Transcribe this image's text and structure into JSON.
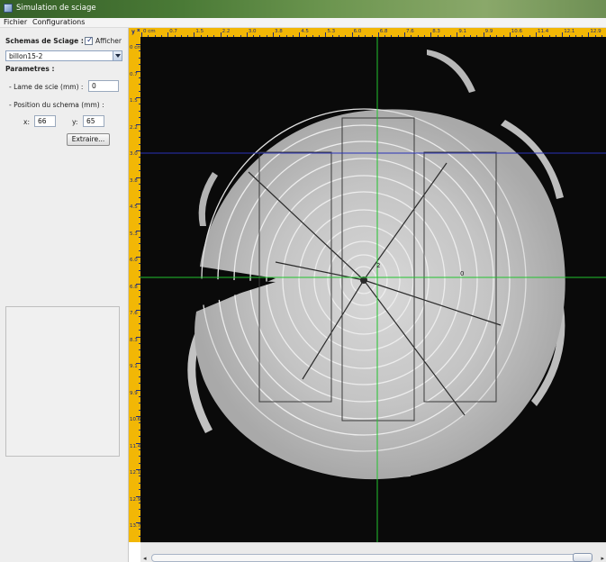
{
  "window": {
    "title": "Simulation de sciage"
  },
  "menu": {
    "items": [
      "Fichier",
      "Configurations"
    ]
  },
  "panel": {
    "schemas_label": "Schemas de Sciage :",
    "afficher_label": "Afficher",
    "afficher_checked": true,
    "selected_schema": "billon15-2",
    "parametres_label": "Parametres :",
    "lame_label": "- Lame de scie (mm) :",
    "lame_value": "0",
    "position_label": "- Position du schema (mm) :",
    "x_label": "x:",
    "x_value": "66",
    "y_label": "y:",
    "y_value": "65",
    "extract_label": "Extraire..."
  },
  "rulers": {
    "corner_y": "y",
    "corner_x": "x",
    "top_labels": [
      "0 cm",
      "0.7",
      "1.5",
      "2.2",
      "3.0",
      "3.8",
      "4.5",
      "5.3",
      "6.0",
      "6.8",
      "7.6",
      "8.3",
      "9.1",
      "9.9",
      "10.6",
      "11.4",
      "12.1",
      "12.9"
    ],
    "left_labels": [
      "0 cm",
      "0.7",
      "1.5",
      "2.2",
      "3.0",
      "3.8",
      "4.5",
      "5.3",
      "6.0",
      "6.8",
      "7.6",
      "8.3",
      "9.1",
      "9.9",
      "10.6",
      "11.4",
      "12.1",
      "12.9",
      "13.7"
    ]
  },
  "canvas": {
    "labels": {
      "center_mark": "2",
      "board_mark": "0"
    },
    "colors": {
      "guide_green": "#22c32e",
      "guide_blue": "#2a33b8",
      "background": "#0a0a0a",
      "ruler": "#f2b705"
    }
  },
  "icons": {
    "app": "app-icon",
    "dropdown": "chevron-down-icon",
    "check": "check-icon",
    "scroll_left": "arrow-left-icon",
    "scroll_right": "arrow-right-icon"
  }
}
